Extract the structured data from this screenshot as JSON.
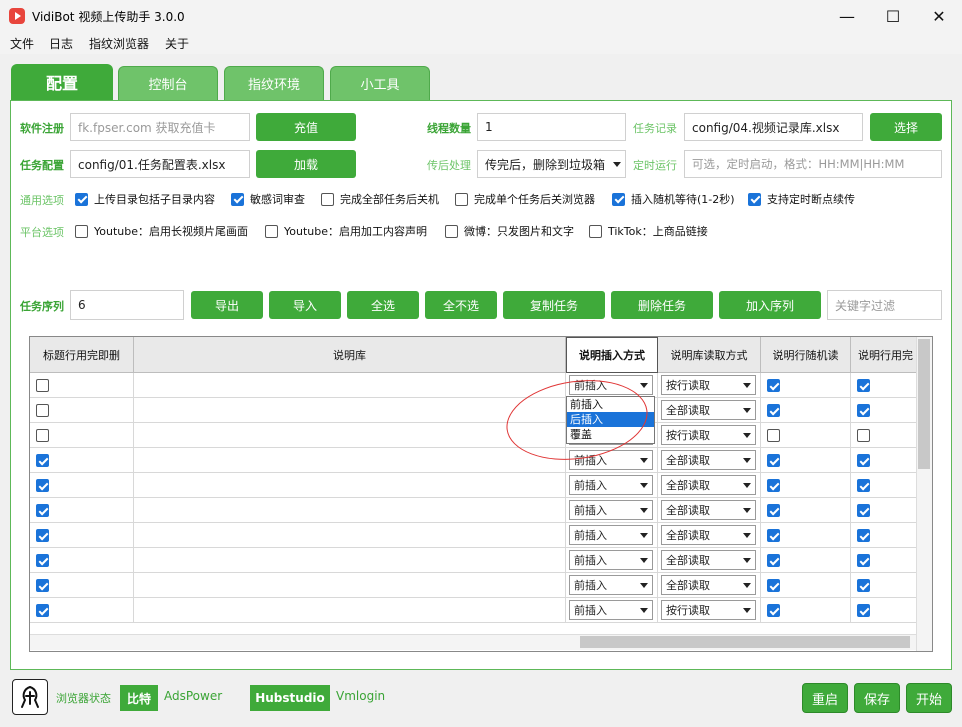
{
  "window": {
    "title": "VidiBot 视频上传助手 3.0.0",
    "controls": {
      "minimize": "—",
      "maximize": "☐",
      "close": "✕"
    }
  },
  "menu": [
    "文件",
    "日志",
    "指纹浏览器",
    "关于"
  ],
  "tabs": [
    {
      "label": "配置",
      "active": true
    },
    {
      "label": "控制台",
      "active": false
    },
    {
      "label": "指纹环境",
      "active": false
    },
    {
      "label": "小工具",
      "active": false
    }
  ],
  "config": {
    "reg_label": "软件注册",
    "reg_placeholder": "fk.fpser.com 获取充值卡",
    "recharge_button": "充值",
    "thread_label": "线程数量",
    "thread_value": "1",
    "record_label": "任务记录",
    "record_value": "config/04.视频记录库.xlsx",
    "choose_button": "选择",
    "task_config_label": "任务配置",
    "task_config_value": "config/01.任务配置表.xlsx",
    "load_button": "加载",
    "post_label": "传后处理",
    "post_value": "传完后，删除到垃圾箱",
    "timer_label": "定时运行",
    "timer_placeholder": "可选，定时启动，格式：HH:MM|HH:MM"
  },
  "general_options": {
    "label": "通用选项",
    "items": [
      {
        "label": "上传目录包括子目录内容",
        "checked": true
      },
      {
        "label": "敏感词审查",
        "checked": true
      },
      {
        "label": "完成全部任务后关机",
        "checked": false
      },
      {
        "label": "完成单个任务后关浏览器",
        "checked": false
      },
      {
        "label": "插入随机等待(1-2秒)",
        "checked": true
      },
      {
        "label": "支持定时断点续传",
        "checked": true
      }
    ]
  },
  "platform_options": {
    "label": "平台选项",
    "items": [
      {
        "label": "Youtube：启用长视频片尾画面",
        "checked": false
      },
      {
        "label": "Youtube：启用加工内容声明",
        "checked": false
      },
      {
        "label": "微博：只发图片和文字",
        "checked": false
      },
      {
        "label": "TikTok：上商品链接",
        "checked": false
      }
    ]
  },
  "sequence": {
    "label": "任务序列",
    "value": "6",
    "buttons": [
      "导出",
      "导入",
      "全选",
      "全不选",
      "复制任务",
      "删除任务",
      "加入序列"
    ],
    "filter_placeholder": "关键字过滤"
  },
  "grid": {
    "headers": [
      "标题行用完即删",
      "说明库",
      "说明插入方式",
      "说明库读取方式",
      "说明行随机读",
      "说明行用完"
    ],
    "rows": [
      {
        "del": false,
        "insert": "前插入",
        "read": "按行读取",
        "rand": true,
        "used": true
      },
      {
        "del": false,
        "insert": "前插入",
        "read": "全部读取",
        "rand": true,
        "used": true
      },
      {
        "del": false,
        "insert": "前插入",
        "read": "按行读取",
        "rand": false,
        "used": false
      },
      {
        "del": true,
        "insert": "前插入",
        "read": "全部读取",
        "rand": true,
        "used": true
      },
      {
        "del": true,
        "insert": "前插入",
        "read": "全部读取",
        "rand": true,
        "used": true
      },
      {
        "del": true,
        "insert": "前插入",
        "read": "全部读取",
        "rand": true,
        "used": true
      },
      {
        "del": true,
        "insert": "前插入",
        "read": "全部读取",
        "rand": true,
        "used": true
      },
      {
        "del": true,
        "insert": "前插入",
        "read": "全部读取",
        "rand": true,
        "used": true
      },
      {
        "del": true,
        "insert": "前插入",
        "read": "全部读取",
        "rand": true,
        "used": true
      },
      {
        "del": true,
        "insert": "前插入",
        "read": "按行读取",
        "rand": true,
        "used": true
      }
    ],
    "dropdown_options": [
      "前插入",
      "后插入",
      "覆盖"
    ],
    "dropdown_highlight": 1
  },
  "footer": {
    "browser_status_label": "浏览器状态",
    "tags": [
      {
        "label": "比特",
        "active": true
      },
      {
        "label": "AdsPower",
        "active": false
      },
      {
        "label": "Hubstudio",
        "active": true
      },
      {
        "label": "Vmlogin",
        "active": false
      }
    ],
    "buttons": [
      "重启",
      "保存",
      "开始"
    ]
  }
}
